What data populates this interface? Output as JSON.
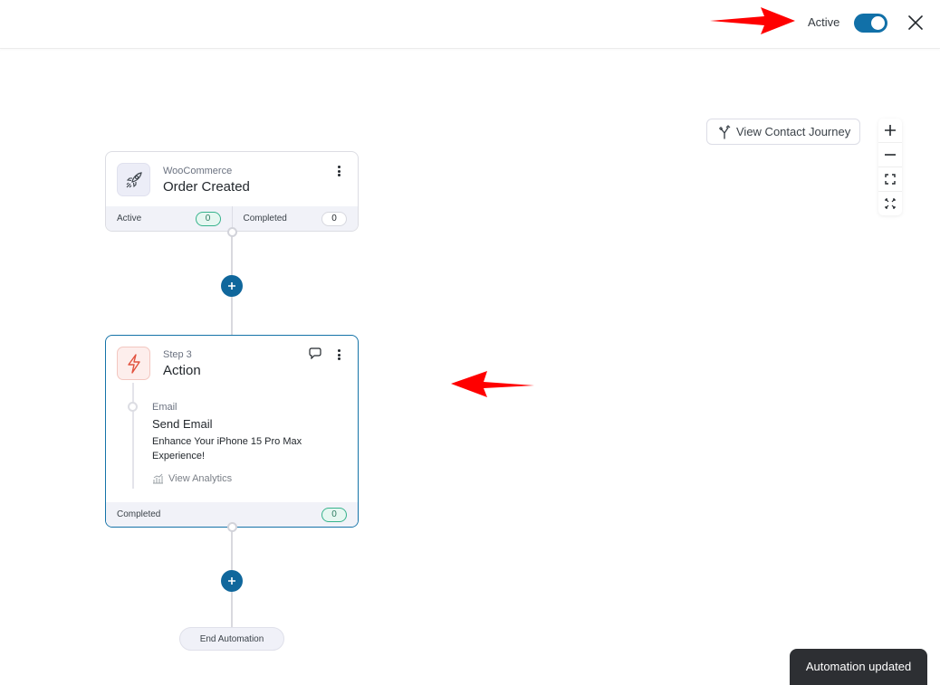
{
  "header": {
    "status_label": "Active",
    "toggle_on": true,
    "accent": "#1170a8"
  },
  "canvas": {
    "journey_button": "View Contact Journey",
    "zoom_controls": [
      "zoom-in",
      "zoom-out",
      "fit-view",
      "fullscreen"
    ]
  },
  "trigger_node": {
    "source": "WooCommerce",
    "title": "Order Created",
    "footer": {
      "active_label": "Active",
      "active_count": "0",
      "completed_label": "Completed",
      "completed_count": "0"
    }
  },
  "action_node": {
    "step": "Step 3",
    "title": "Action",
    "item": {
      "type": "Email",
      "title": "Send Email",
      "description": "Enhance Your iPhone 15 Pro Max Experience!",
      "analytics_link": "View Analytics"
    },
    "footer": {
      "completed_label": "Completed",
      "completed_count": "0"
    }
  },
  "end_node": {
    "label": "End Automation"
  },
  "toast": {
    "message": "Automation updated"
  },
  "annotations": {
    "arrow_color": "#ff0000"
  }
}
